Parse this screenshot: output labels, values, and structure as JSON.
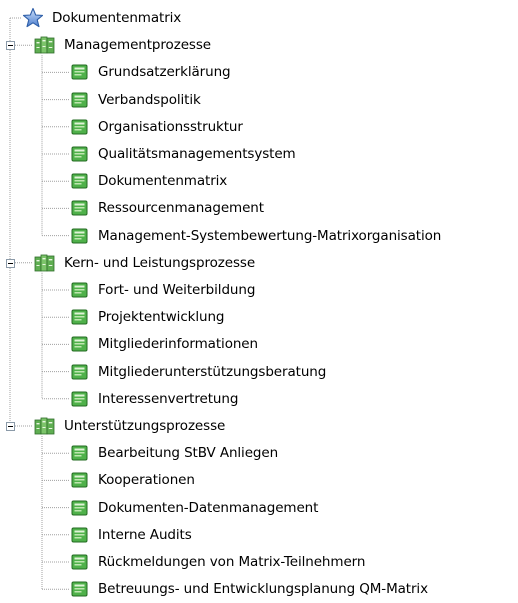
{
  "tree": {
    "root": {
      "label": "Dokumentenmatrix",
      "icon": "star-icon"
    },
    "groups": [
      {
        "label": "Managementprozesse",
        "icon": "book-stack-icon",
        "expanded": true,
        "items": [
          {
            "label": "Grundsatzerklärung",
            "icon": "document-icon"
          },
          {
            "label": "Verbandspolitik",
            "icon": "document-icon"
          },
          {
            "label": "Organisationsstruktur",
            "icon": "document-icon"
          },
          {
            "label": "Qualitätsmanagementsystem",
            "icon": "document-icon"
          },
          {
            "label": "Dokumentenmatrix",
            "icon": "document-icon"
          },
          {
            "label": "Ressourcenmanagement",
            "icon": "document-icon"
          },
          {
            "label": "Management-Systembewertung-Matrixorganisation",
            "icon": "document-icon"
          }
        ]
      },
      {
        "label": "Kern- und Leistungsprozesse",
        "icon": "book-stack-icon",
        "expanded": true,
        "items": [
          {
            "label": "Fort- und Weiterbildung",
            "icon": "document-icon"
          },
          {
            "label": "Projektentwicklung",
            "icon": "document-icon"
          },
          {
            "label": "Mitgliederinformationen",
            "icon": "document-icon"
          },
          {
            "label": "Mitgliederunterstützungsberatung",
            "icon": "document-icon"
          },
          {
            "label": "Interessenvertretung",
            "icon": "document-icon"
          }
        ]
      },
      {
        "label": "Unterstützungsprozesse",
        "icon": "book-stack-icon",
        "expanded": true,
        "items": [
          {
            "label": "Bearbeitung StBV Anliegen",
            "icon": "document-icon"
          },
          {
            "label": "Kooperationen",
            "icon": "document-icon"
          },
          {
            "label": "Dokumenten-Datenmanagement",
            "icon": "document-icon"
          },
          {
            "label": "Interne Audits",
            "icon": "document-icon"
          },
          {
            "label": "Rückmeldungen von Matrix-Teilnehmern",
            "icon": "document-icon"
          },
          {
            "label": "Betreuungs- und Entwicklungsplanung QM-Matrix",
            "icon": "document-icon"
          }
        ]
      }
    ]
  },
  "colors": {
    "text": "#000000",
    "tree_line": "#a0a0a0",
    "toggle_border": "#8b9aa8",
    "document_green": "#3aa23a",
    "star_blue": "#5b8fd6"
  }
}
